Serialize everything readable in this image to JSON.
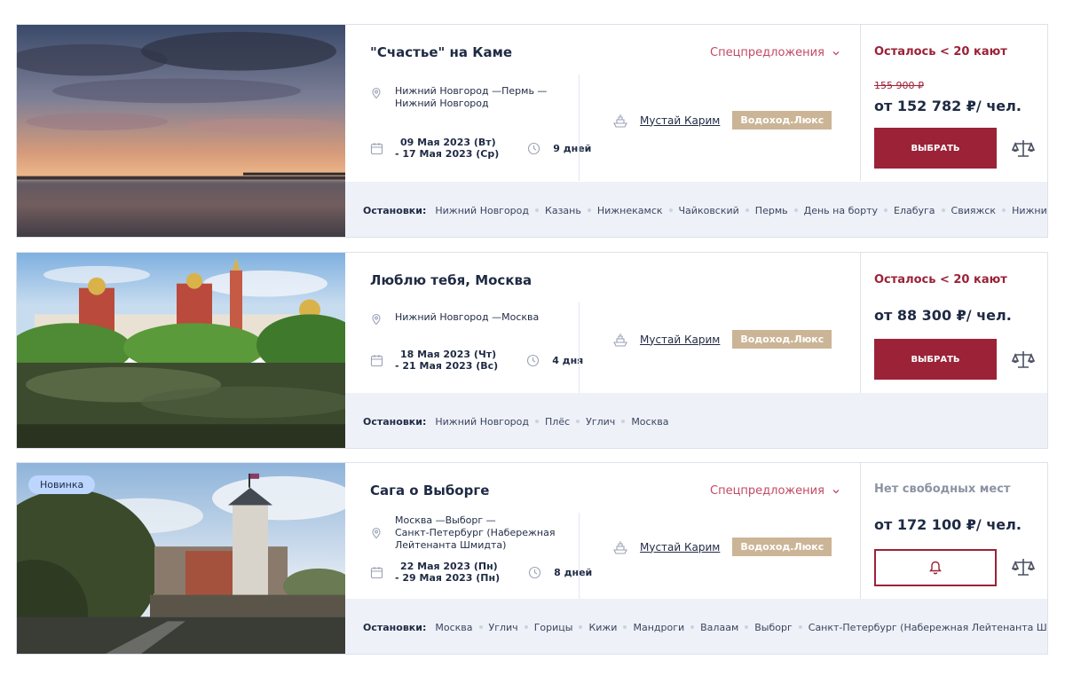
{
  "cards": [
    {
      "title": "\"Счастье\" на Каме",
      "special": "Спецпредложения",
      "route": [
        "Нижний Новгород —Пермь —",
        "Нижний Новгород"
      ],
      "date_start": "09 Мая 2023 (Вт)",
      "date_end": "- 17 Мая 2023 (Ср)",
      "duration": "9 дней",
      "ship": "Мустай Карим",
      "ship_class": "Водоход.Люкс",
      "availability": "Осталось < 20 кают",
      "old_price": "155 900 ₽",
      "price": "от 152 782 ₽/ чел.",
      "button": "ВЫБРАТЬ",
      "stops_label": "Остановки:",
      "stops": [
        "Нижний Новгород",
        "Казань",
        "Нижнекамск",
        "Чайковский",
        "Пермь",
        "День на борту",
        "Елабуга",
        "Свияжск",
        "Нижний Новгород"
      ]
    },
    {
      "title": "Люблю тебя, Москва",
      "route": [
        "Нижний Новгород —Москва"
      ],
      "date_start": "18 Мая 2023 (Чт)",
      "date_end": "- 21 Мая 2023 (Вс)",
      "duration": "4 дня",
      "ship": "Мустай Карим",
      "ship_class": "Водоход.Люкс",
      "availability": "Осталось < 20 кают",
      "price": "от 88 300 ₽/ чел.",
      "button": "ВЫБРАТЬ",
      "stops_label": "Остановки:",
      "stops": [
        "Нижний Новгород",
        "Плёс",
        "Углич",
        "Москва"
      ]
    },
    {
      "tag": "Новинка",
      "title": "Сага о Выборге",
      "special": "Спецпредложения",
      "route": [
        "Москва —Выборг —",
        "Санкт-Петербург (Набережная",
        "Лейтенанта Шмидта)"
      ],
      "date_start": "22 Мая 2023 (Пн)",
      "date_end": "- 29 Мая 2023 (Пн)",
      "duration": "8 дней",
      "ship": "Мустай Карим",
      "ship_class": "Водоход.Люкс",
      "availability": "Нет свободных мест",
      "price": "от 172 100 ₽/ чел.",
      "stops_label": "Остановки:",
      "stops": [
        "Москва",
        "Углич",
        "Горицы",
        "Кижи",
        "Мандроги",
        "Валаам",
        "Выборг",
        "Санкт-Петербург (Набережная Лейтенанта Шмидта)"
      ]
    }
  ],
  "icons": {
    "pin": "map-pin-icon",
    "calendar": "calendar-icon",
    "clock": "clock-icon",
    "ship": "ship-icon",
    "chevron": "chevron-down-icon",
    "bell": "bell-icon",
    "compare": "compare-scales-icon"
  },
  "colors": {
    "accent": "#9b2237",
    "special": "#c24a63",
    "badge": "#cbb596",
    "stops_bg": "#eef1f8",
    "new_tag": "#bcd6ff"
  }
}
